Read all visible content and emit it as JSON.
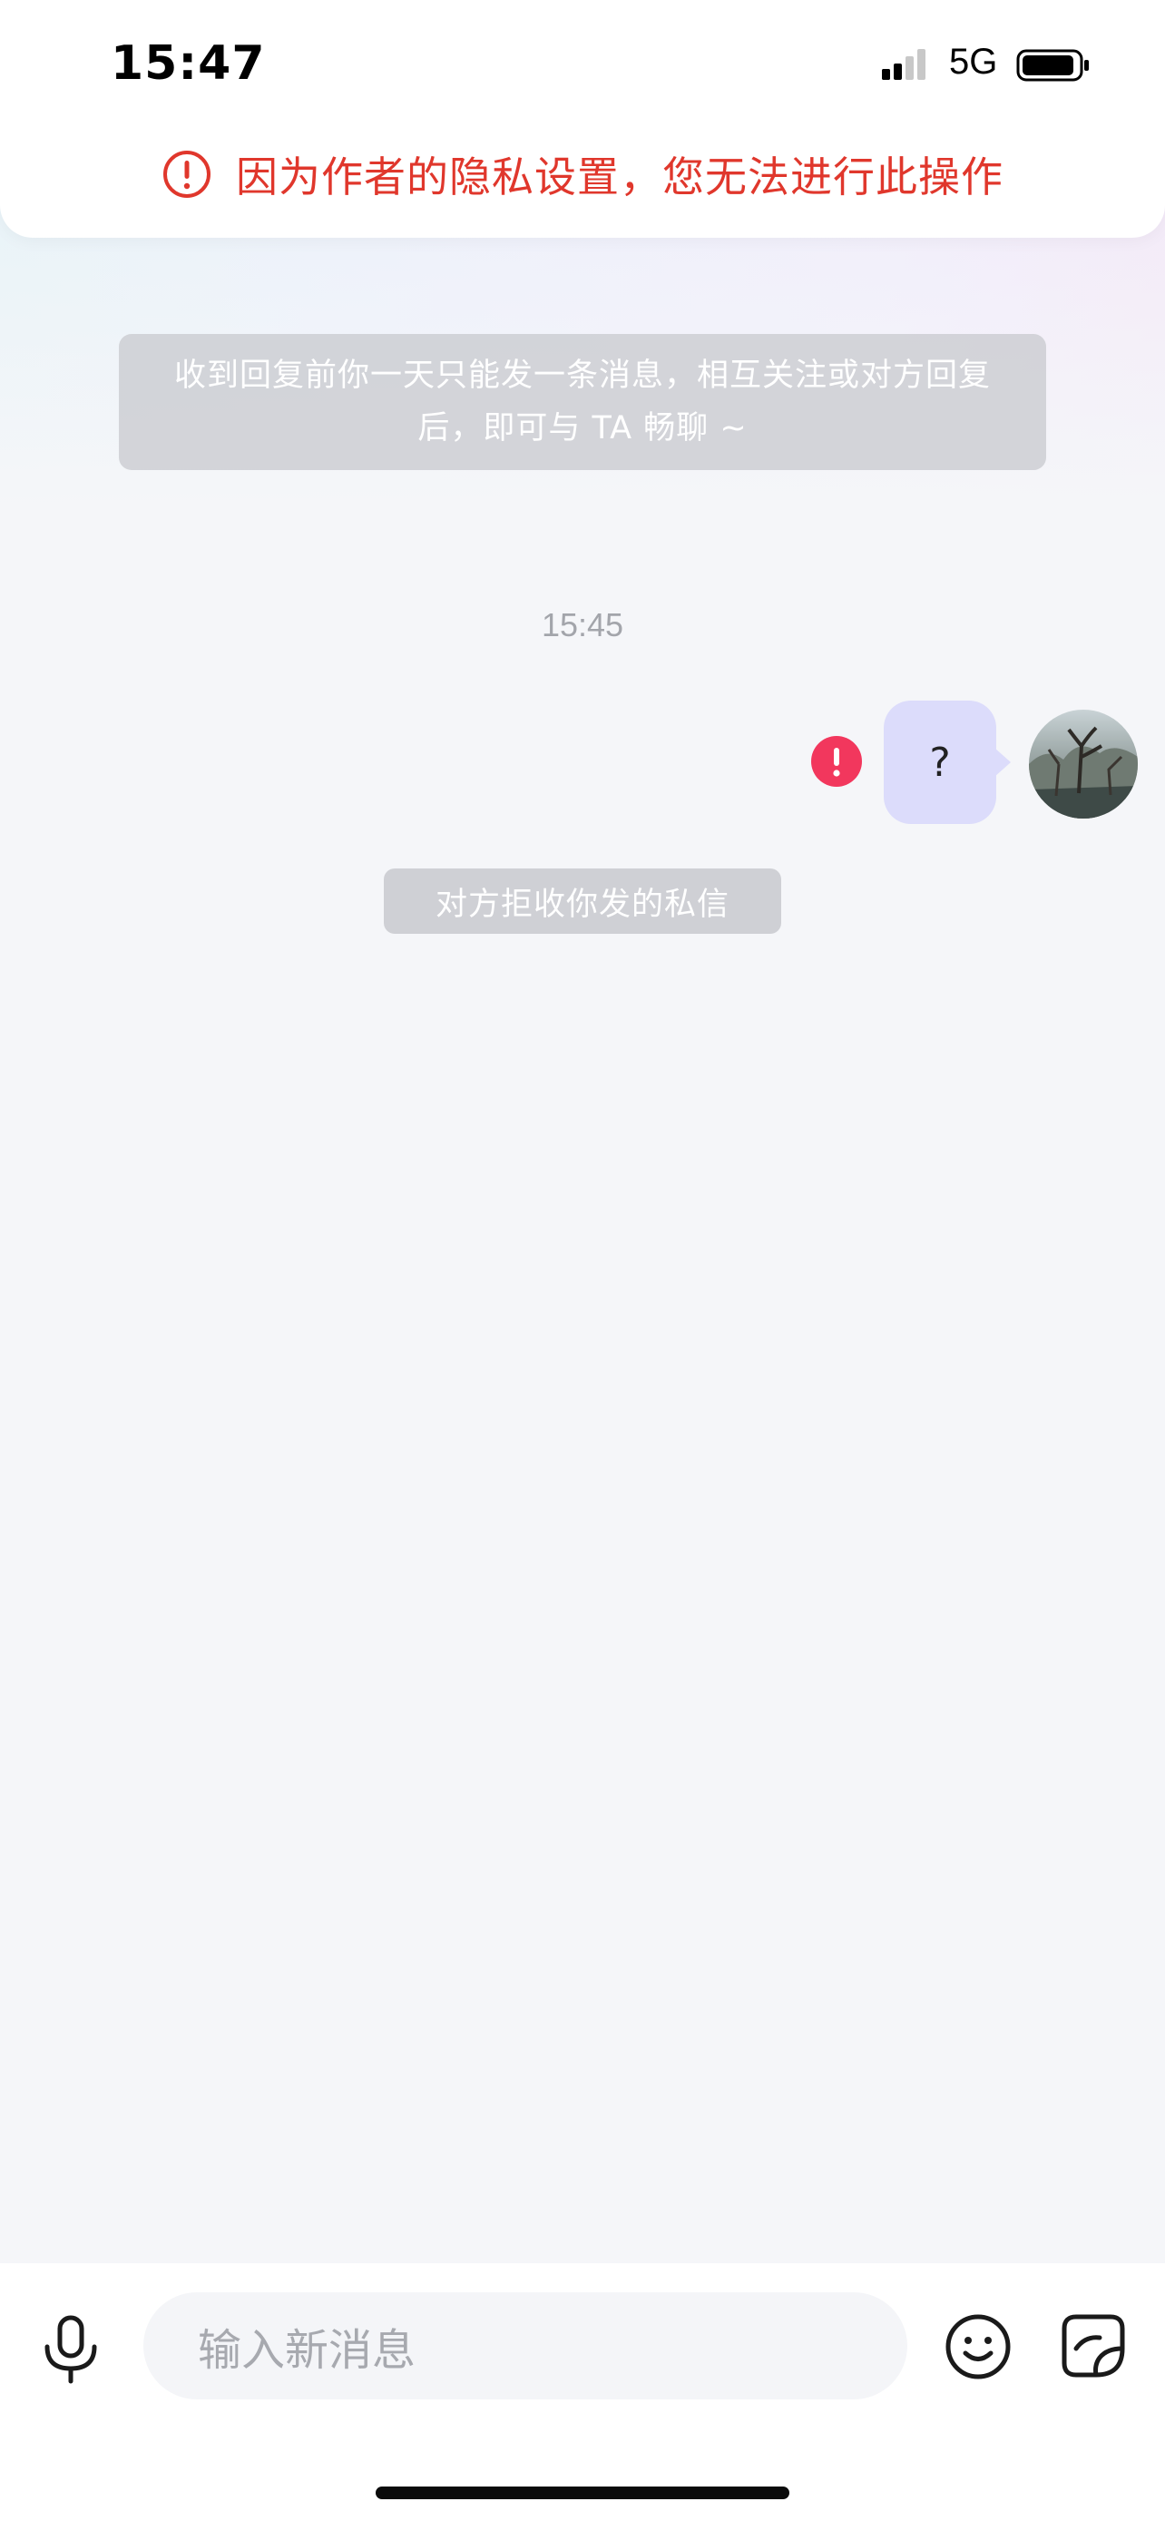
{
  "status_bar": {
    "time": "15:47",
    "network": "5G",
    "icons": [
      "signal-icon",
      "battery-icon"
    ]
  },
  "toast": {
    "icon": "alert-circle-icon",
    "text": "因为作者的隐私设置，您无法进行此操作",
    "color": "#e0372c"
  },
  "notice": {
    "line1": "收到回复前你一天只能发一条消息，相互关注或对方回复",
    "line2": "后，即可与 TA 畅聊 ~"
  },
  "conversation": {
    "timestamp": "15:45",
    "messages": [
      {
        "text": "?",
        "status_icon": "send-failed-icon",
        "bubble_color": "#dcdcfb"
      }
    ],
    "system_message": "对方拒收你发的私信"
  },
  "composer": {
    "placeholder": "输入新消息",
    "icons": [
      "microphone-icon",
      "emoji-icon",
      "sticker-icon"
    ]
  }
}
